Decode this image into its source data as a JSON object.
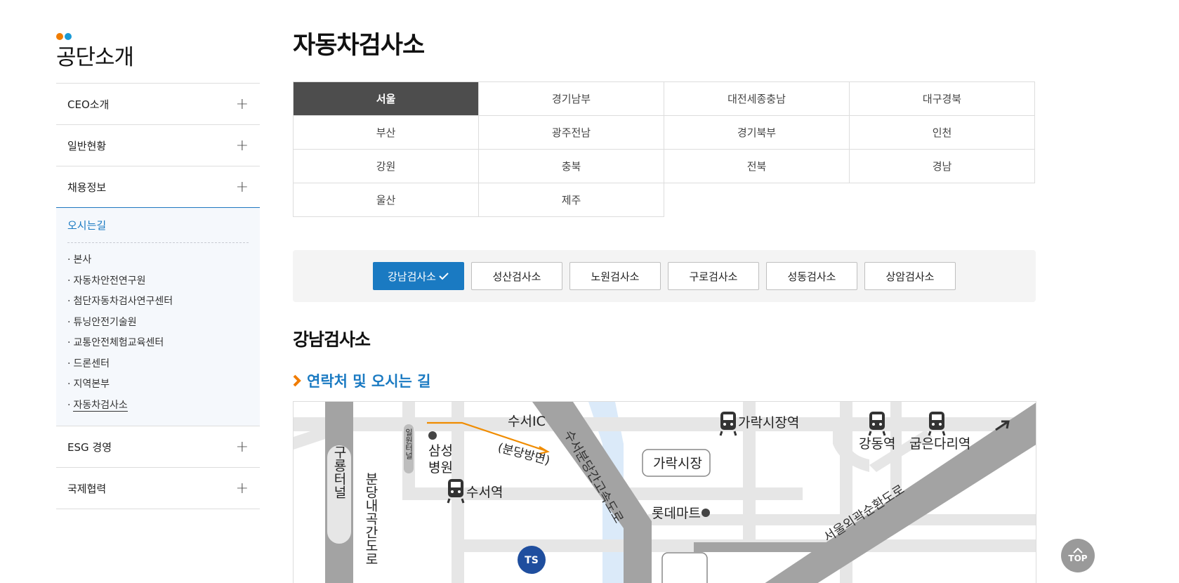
{
  "sidebar": {
    "title": "공단소개",
    "dot_colors": [
      "#f07c00",
      "#1a9ad6"
    ],
    "menu": [
      {
        "label": "CEO소개"
      },
      {
        "label": "일반현황"
      },
      {
        "label": "채용정보"
      }
    ],
    "sub_menu": {
      "title": "오시는길",
      "items": [
        "본사",
        "자동차안전연구원",
        "첨단자동차검사연구센터",
        "튜닝안전기술원",
        "교통안전체험교육센터",
        "드론센터",
        "지역본부",
        "자동차검사소"
      ]
    },
    "menu_bottom": [
      {
        "label": "ESG 경영"
      },
      {
        "label": "국제협력"
      }
    ]
  },
  "main": {
    "title": "자동차검사소",
    "regions": [
      [
        "서울",
        "경기남부",
        "대전세종충남",
        "대구경북"
      ],
      [
        "부산",
        "광주전남",
        "경기북부",
        "인천"
      ],
      [
        "강원",
        "충북",
        "전북",
        "경남"
      ],
      [
        "울산",
        "제주"
      ]
    ],
    "centers": [
      "강남검사소",
      "성산검사소",
      "노원검사소",
      "구로검사소",
      "성동검사소",
      "상암검사소"
    ],
    "selected_center": "강남검사소",
    "section_heading": "연락처 및 오시는 길"
  },
  "map": {
    "labels": {
      "suseo_ic": "수서IC",
      "bundang_dir": "(분당방면)",
      "samsung_hospital_1": "삼성",
      "samsung_hospital_2": "병원",
      "ilwon_tunnel": "일원터널",
      "guryong_tunnel": "구룡터널",
      "bundang_road": "분당내곡간도로",
      "suseo_station": "수서역",
      "garak_market_station": "가락시장역",
      "garak_market": "가락시장",
      "gangdong_station": "강동역",
      "gubeundari_station": "굽은다리역",
      "lotte_mart": "롯데마트",
      "ring_road": "서울외곽순환도로",
      "expressway": "수서분당간고속도로",
      "ts_logo": "TS"
    }
  },
  "top_button": "TOP",
  "colors": {
    "accent": "#1a7ac2",
    "active_region": "#4d4d4d",
    "orange": "#f07c00"
  }
}
